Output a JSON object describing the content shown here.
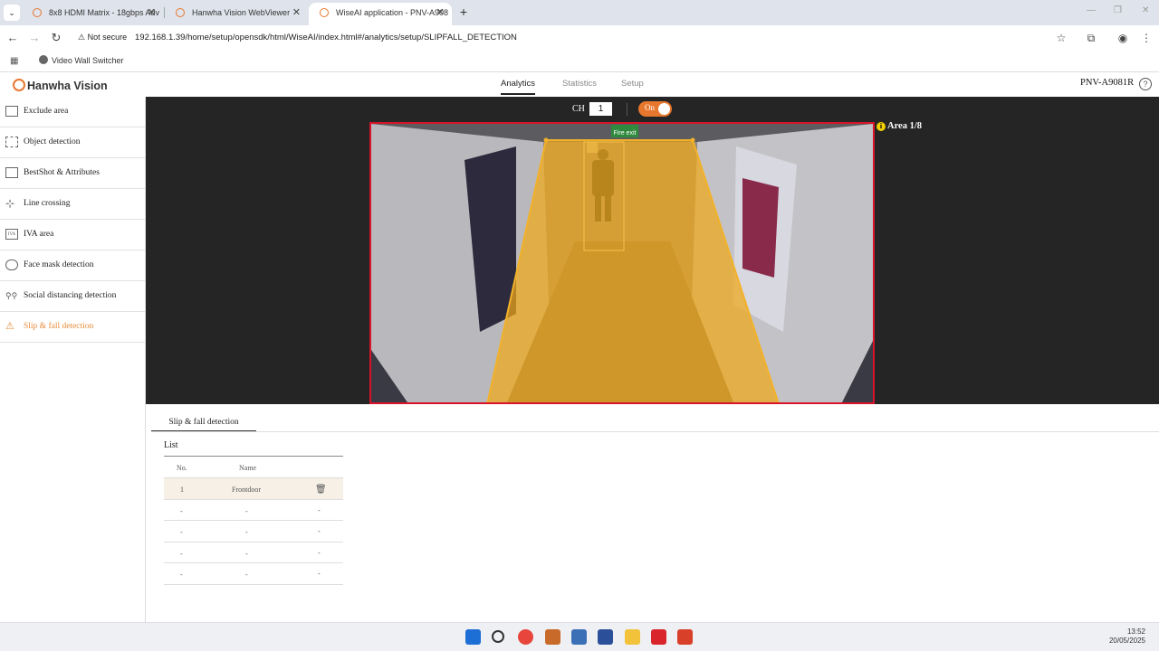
{
  "browser": {
    "tabs": [
      {
        "title": "8x8 HDMI Matrix - 18gbps Adv",
        "active": false
      },
      {
        "title": "Hanwha Vision WebViewer",
        "active": false
      },
      {
        "title": "WiseAI application - PNV-A908",
        "active": true
      }
    ],
    "new_tab": "+",
    "security_label": "Not secure",
    "url": "192.168.1.39/home/setup/opensdk/html/WiseAI/index.html#/analytics/setup/SLIPFALL_DETECTION",
    "bookmark": "Video Wall Switcher"
  },
  "app": {
    "brand": "Hanwha Vision",
    "nav": [
      {
        "label": "Analytics",
        "active": true
      },
      {
        "label": "Statistics",
        "active": false
      },
      {
        "label": "Setup",
        "active": false
      }
    ],
    "model": "PNV-A9081R",
    "help": "?"
  },
  "sidebar": {
    "items": [
      {
        "label": "Exclude area",
        "icon": "exclude-area-icon",
        "active": false
      },
      {
        "label": "Object detection",
        "icon": "object-detection-icon",
        "active": false
      },
      {
        "label": "BestShot & Attributes",
        "icon": "bestshot-icon",
        "active": false
      },
      {
        "label": "Line crossing",
        "icon": "line-crossing-icon",
        "active": false
      },
      {
        "label": "IVA area",
        "icon": "iva-area-icon",
        "active": false
      },
      {
        "label": "Face mask detection",
        "icon": "face-mask-icon",
        "active": false
      },
      {
        "label": "Social distancing detection",
        "icon": "social-distancing-icon",
        "active": false
      },
      {
        "label": "Slip & fall detection",
        "icon": "slip-fall-icon",
        "active": true
      }
    ]
  },
  "viewer": {
    "ch_label": "CH",
    "ch_value": "1",
    "toggle_label": "On",
    "area_label": "Area 1/8",
    "sign_text": "Fire exit"
  },
  "panel": {
    "tab": "Slip & fall detection",
    "list_title": "List",
    "columns": [
      "No.",
      "Name"
    ],
    "rows": [
      {
        "no": "1",
        "name": "Frontdoor",
        "action": "delete"
      },
      {
        "no": "-",
        "name": "-",
        "action": "-"
      },
      {
        "no": "-",
        "name": "-",
        "action": "-"
      },
      {
        "no": "-",
        "name": "-",
        "action": "-"
      },
      {
        "no": "-",
        "name": "-",
        "action": "-"
      }
    ]
  },
  "taskbar": {
    "time": "13:52",
    "date": "20/05/2025"
  },
  "colors": {
    "accent": "#e8772e",
    "area_border": "#d7142a",
    "zone_fill": "#f0a818",
    "active_item": "#e88b3a"
  }
}
